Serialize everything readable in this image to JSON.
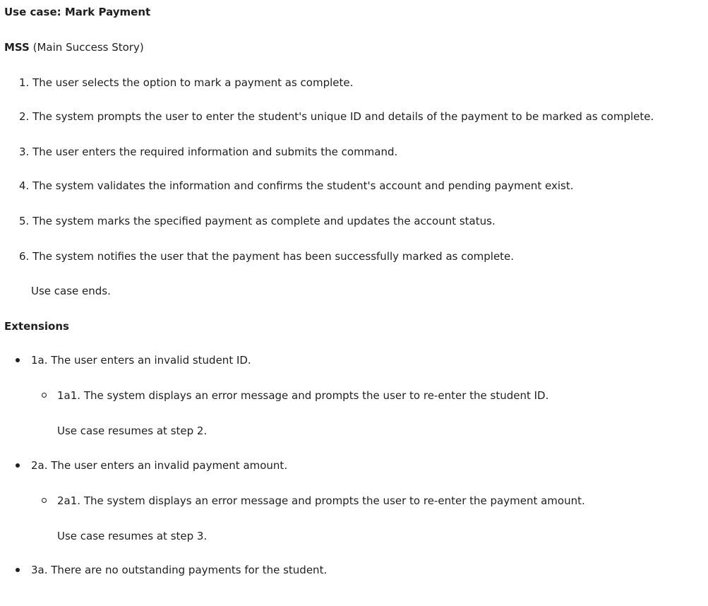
{
  "title": "Use case: Mark Payment",
  "mss": {
    "label": "MSS",
    "note": "(Main Success Story)"
  },
  "steps": [
    {
      "num": "1.",
      "text": "The user selects the option to mark a payment as complete."
    },
    {
      "num": "2.",
      "text": "The system prompts the user to enter the student's unique ID and details of the payment to be marked as complete."
    },
    {
      "num": "3.",
      "text": "The user enters the required information and submits the command."
    },
    {
      "num": "4.",
      "text": "The system validates the information and confirms the student's account and pending payment exist."
    },
    {
      "num": "5.",
      "text": "The system marks the specified payment as complete and updates the account status."
    },
    {
      "num": "6.",
      "text": "The system notifies the user that the payment has been successfully marked as complete."
    }
  ],
  "use_case_ends": "Use case ends.",
  "extensions_heading": "Extensions",
  "extensions": [
    {
      "text": "1a. The user enters an invalid student ID.",
      "sub": "1a1. The system displays an error message and prompts the user to re-enter the student ID.",
      "resume": "Use case resumes at step 2."
    },
    {
      "text": "2a. The user enters an invalid payment amount.",
      "sub": "2a1. The system displays an error message and prompts the user to re-enter the payment amount.",
      "resume": "Use case resumes at step 3."
    },
    {
      "text": "3a. There are no outstanding payments for the student."
    }
  ]
}
